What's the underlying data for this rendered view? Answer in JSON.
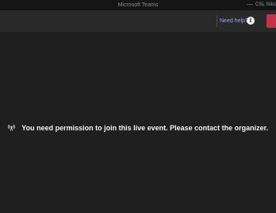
{
  "window": {
    "title": "Microsoft Teams",
    "minimize_glyph": "—",
    "account_name": "CSL Silico"
  },
  "toolbar": {
    "help_label": "Need help?",
    "info_icon_glyph": "i"
  },
  "main": {
    "message": "You need permission to join this live event. Please contact the organizer.",
    "message_icon": "broadcast-icon"
  },
  "colors": {
    "background": "#1f1f1f",
    "titlebar": "#151515",
    "toolbar": "#292929",
    "link": "#9ea2ff",
    "leave_button": "#c4314b",
    "message_text": "#f2f2f2"
  }
}
